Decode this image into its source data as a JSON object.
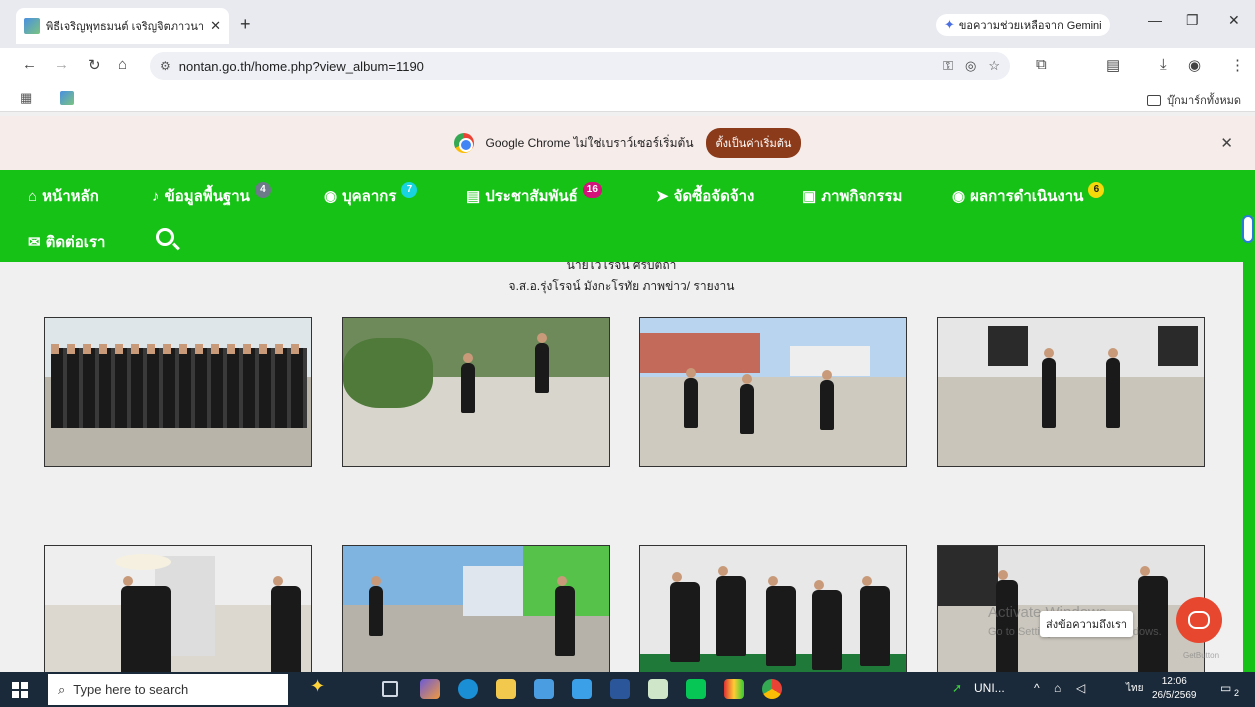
{
  "browser": {
    "tab_title": "พิธีเจริญพุทธมนต์ เจริญจิตภาวนา (ม",
    "tab_close": "✕",
    "new_tab": "+",
    "gemini_label": "ขอความช่วยเหลือจาก Gemini",
    "url": "nontan.go.th/home.php?view_album=1190",
    "all_bookmarks": "บุ๊กมาร์กทั้งหมด"
  },
  "infobar": {
    "message": "Google Chrome ไม่ใช่เบราว์เซอร์เริ่มต้น",
    "button": "ตั้งเป็นค่าเริ่มต้น",
    "close": "✕"
  },
  "sitenav": {
    "items": [
      {
        "icon": "home-icon",
        "label": "หน้าหลัก",
        "badge": ""
      },
      {
        "icon": "bell-icon",
        "label": "ข้อมูลพื้นฐาน",
        "badge": "4",
        "badge_color": "#6c7a89"
      },
      {
        "icon": "user-circle-icon",
        "label": "บุคลากร",
        "badge": "7",
        "badge_color": "#19d3e0"
      },
      {
        "icon": "newspaper-icon",
        "label": "ประชาสัมพันธ์",
        "badge": "16",
        "badge_color": "#d4147a"
      },
      {
        "icon": "paper-plane-icon",
        "label": "จัดซื้อจัดจ้าง",
        "badge": ""
      },
      {
        "icon": "image-icon",
        "label": "ภาพกิจกรรม",
        "badge": ""
      },
      {
        "icon": "user-circle-icon",
        "label": "ผลการดำเนินงาน",
        "badge": "6",
        "badge_color": "#f5d90a"
      },
      {
        "icon": "envelope-icon",
        "label": "ติดต่อเรา",
        "badge": ""
      }
    ]
  },
  "content": {
    "caption_line1": "นายไวโรจน์ ศรีบัตถา",
    "caption_line2": "จ.ส.อ.รุ่งโรจน์ มังกะโรทัย ภาพข่าว/ รายงาน"
  },
  "overlay": {
    "watermark_title": "Activate Windows",
    "watermark_sub": "Go to Settings to activate Windows.",
    "chat_tip": "ส่งข้อความถึงเรา",
    "getbutton": "GetButton"
  },
  "taskbar": {
    "search_placeholder": "Type here to search",
    "tray_app": "UNI...",
    "lang": "ไทย",
    "time": "12:06",
    "date": "26/5/2569",
    "notif_count": "2"
  },
  "colors": {
    "nav_green": "#17c217",
    "infobar_bg": "#f6ecea",
    "set_default_btn": "#8b3a1a",
    "chat_btn": "#e8472f"
  }
}
